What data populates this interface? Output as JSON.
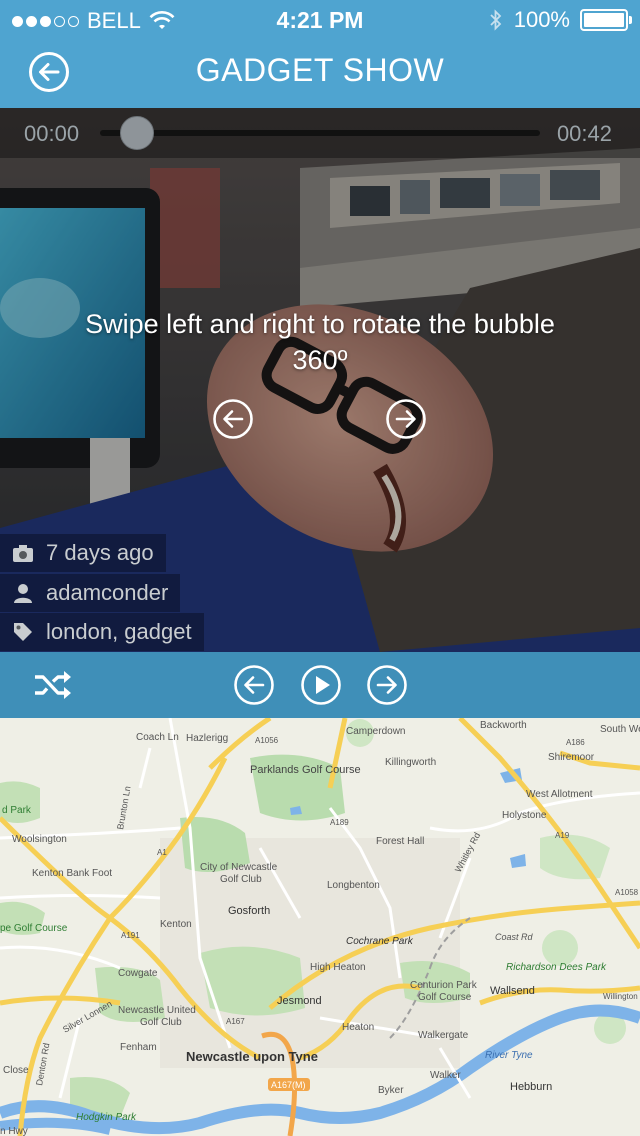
{
  "status_bar": {
    "carrier": "BELL",
    "signal_dots": 3,
    "signal_total": 5,
    "time": "4:21 PM",
    "battery": "100%",
    "battery_level": 1.0
  },
  "header": {
    "title": "GADGET SHOW"
  },
  "player": {
    "elapsed": "00:00",
    "duration": "00:42",
    "progress": 0.0,
    "hint": "Swipe left and right to rotate the bubble 360º"
  },
  "meta": {
    "time_ago": "7 days ago",
    "user": "adamconder",
    "tags": "london, gadget"
  },
  "colors": {
    "header_bg": "#4fa4d0",
    "controls_bg": "#3f8fb8"
  },
  "icons": {
    "back": "back-arrow-icon",
    "shuffle": "shuffle-icon",
    "previous": "previous-icon",
    "play": "play-icon",
    "next": "next-icon",
    "camera": "camera-icon",
    "user": "user-icon",
    "tag": "tag-icon"
  },
  "map": {
    "labels": {
      "backworth": "Backworth",
      "coach_ln": "Coach Ln",
      "hazlerigg": "Hazlerigg",
      "a1056": "A1056",
      "camperdown": "Camperdown",
      "a186": "A186",
      "south_we": "South We",
      "shiremoor": "Shiremoor",
      "parklands": "Parklands Golf Course",
      "killingworth": "Killingworth",
      "d_park": "d Park",
      "brunton_ln": "Brunton Ln",
      "west_allotment": "West Allotment",
      "a189": "A189",
      "holystone": "Holystone",
      "woolsington": "Woolsington",
      "forest_hall": "Forest Hall",
      "a19": "A19",
      "whitley_rd": "Whitley Rd",
      "a1": "A1",
      "city_of_newcastle_golf_1": "City of Newcastle",
      "city_of_newcastle_golf_2": "Golf Club",
      "kenton_bank_foot": "Kenton Bank Foot",
      "longbenton": "Longbenton",
      "a1058": "A1058",
      "gosforth": "Gosforth",
      "kenton": "Kenton",
      "pe_golf_course": "pe Golf Course",
      "cochrane_park": "Cochrane Park",
      "coast_rd": "Coast Rd",
      "a191": "A191",
      "high_heaton": "High Heaton",
      "richardson_dees_park": "Richardson Dees Park",
      "cowgate": "Cowgate",
      "centurion_park_golf_1": "Centurion Park",
      "centurion_park_golf_2": "Golf Course",
      "wallsend": "Wallsend",
      "willington_quay": "Willington Quay",
      "jesmond": "Jesmond",
      "silver_lonnen": "Silver Lonnen",
      "newcastle_united_golf_1": "Newcastle United",
      "newcastle_united_golf_2": "Golf Club",
      "a167": "A167",
      "heaton": "Heaton",
      "walkergate": "Walkergate",
      "fenham": "Fenham",
      "river_tyne": "River Tyne",
      "denton_rd": "Denton Rd",
      "newcastle_upon_tyne": "Newcastle upon Tyne",
      "close": "Close",
      "a167m": "A167(M)",
      "walker": "Walker",
      "byker": "Byker",
      "hebburn": "Hebburn",
      "hodgkin_park": "Hodgkin Park",
      "n_hwy": "n Hwy"
    }
  }
}
